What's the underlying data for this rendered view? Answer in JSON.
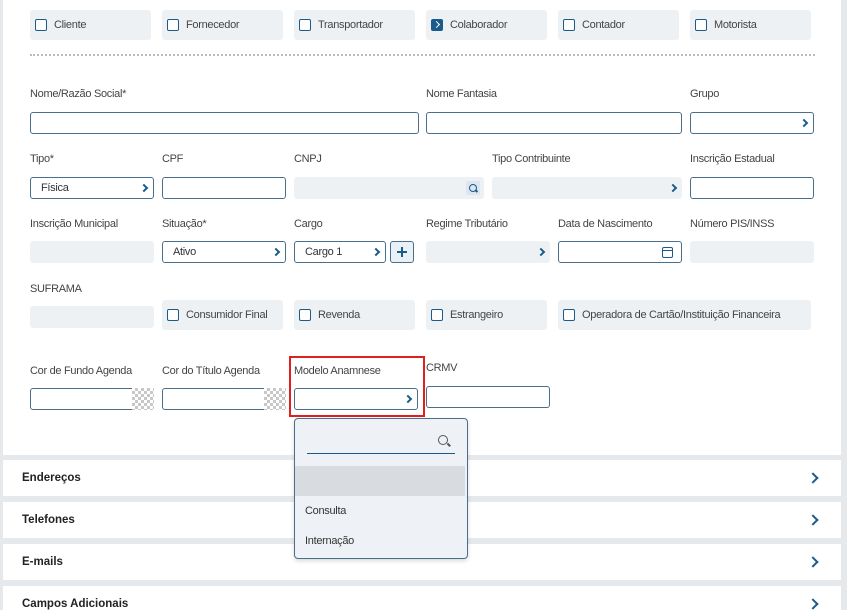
{
  "roles": [
    "Cliente",
    "Fornecedor",
    "Transportador",
    "Colaborador",
    "Contador",
    "Motorista"
  ],
  "roles_checked": [
    false,
    false,
    false,
    true,
    false,
    false
  ],
  "labels": {
    "nome_razao": "Nome/Razão Social*",
    "nome_fantasia": "Nome Fantasia",
    "grupo": "Grupo",
    "tipo": "Tipo*",
    "cpf": "CPF",
    "cnpj": "CNPJ",
    "tipo_contribuinte": "Tipo Contribuinte",
    "inscricao_estadual": "Inscrição Estadual",
    "inscricao_municipal": "Inscrição Municipal",
    "situacao": "Situação*",
    "cargo": "Cargo",
    "regime_tributario": "Regime Tributário",
    "data_nascimento": "Data de Nascimento",
    "pis_inss": "Número PIS/INSS",
    "suframa": "SUFRAMA",
    "cor_fundo_agenda": "Cor de Fundo Agenda",
    "cor_titulo_agenda": "Cor do Título Agenda",
    "modelo_anamnese": "Modelo Anamnese",
    "crmv": "CRMV"
  },
  "values": {
    "tipo": "Física",
    "situacao": "Ativo",
    "cargo": "Cargo 1"
  },
  "flags": [
    "Consumidor Final",
    "Revenda",
    "Estrangeiro",
    "Operadora de Cartão/Instituição Financeira"
  ],
  "dropdown": {
    "options": [
      "",
      "Consulta",
      "Internação"
    ]
  },
  "sections": [
    "Endereços",
    "Telefones",
    "E-mails",
    "Campos Adicionais"
  ],
  "colors": {
    "accent": "#1a5b8a",
    "highlight": "#e01f1f"
  },
  "icons": [
    "checkbox-icon",
    "chevron-right-icon",
    "search-icon",
    "calendar-icon",
    "plus-icon"
  ]
}
